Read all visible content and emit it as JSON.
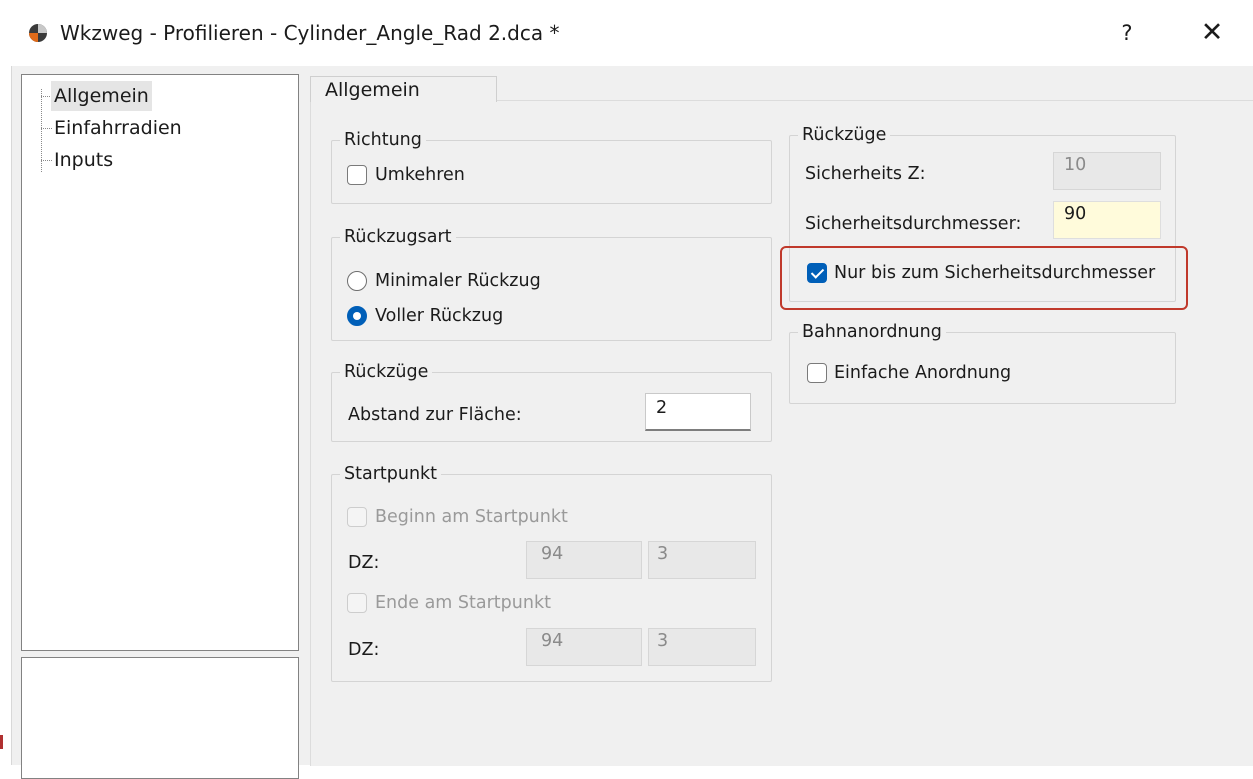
{
  "window": {
    "title": "Wkzweg - Profilieren - Cylinder_Angle_Rad 2.dca *",
    "help_label": "?",
    "close_label": "✕"
  },
  "tree": {
    "items": [
      {
        "label": "Allgemein",
        "selected": true
      },
      {
        "label": "Einfahrradien",
        "selected": false
      },
      {
        "label": "Inputs",
        "selected": false
      }
    ]
  },
  "tabs": [
    {
      "label": "Allgemein",
      "active": true
    }
  ],
  "richtung": {
    "title": "Richtung",
    "umkehren_label": "Umkehren",
    "umkehren_checked": false
  },
  "rueckzugsart": {
    "title": "Rückzugsart",
    "options": [
      {
        "label": "Minimaler Rückzug",
        "selected": false
      },
      {
        "label": "Voller Rückzug",
        "selected": true
      }
    ]
  },
  "rueckzuege_left": {
    "title": "Rückzüge",
    "abstand_label": "Abstand zur Fläche:",
    "abstand_value": "2"
  },
  "startpunkt": {
    "title": "Startpunkt",
    "beginn_label": "Beginn am Startpunkt",
    "beginn_checked": false,
    "dz1_label": "DZ:",
    "dz1_a": "94",
    "dz1_b": "3",
    "ende_label": "Ende am Startpunkt",
    "ende_checked": false,
    "dz2_label": "DZ:",
    "dz2_a": "94",
    "dz2_b": "3"
  },
  "rueckzuege_right": {
    "title": "Rückzüge",
    "sicherheits_z_label": "Sicherheits Z:",
    "sicherheits_z_value": "10",
    "sicherheitsdurchmesser_label": "Sicherheitsdurchmesser:",
    "sicherheitsdurchmesser_value": "90",
    "nur_bis_label": "Nur bis zum Sicherheitsdurchmesser",
    "nur_bis_checked": true
  },
  "bahnanordnung": {
    "title": "Bahnanordnung",
    "einfache_label": "Einfache Anordnung",
    "einfache_checked": false
  },
  "colors": {
    "accent": "#005fb8",
    "highlight": "#c0392b",
    "field_yellow": "#fffbdb"
  }
}
